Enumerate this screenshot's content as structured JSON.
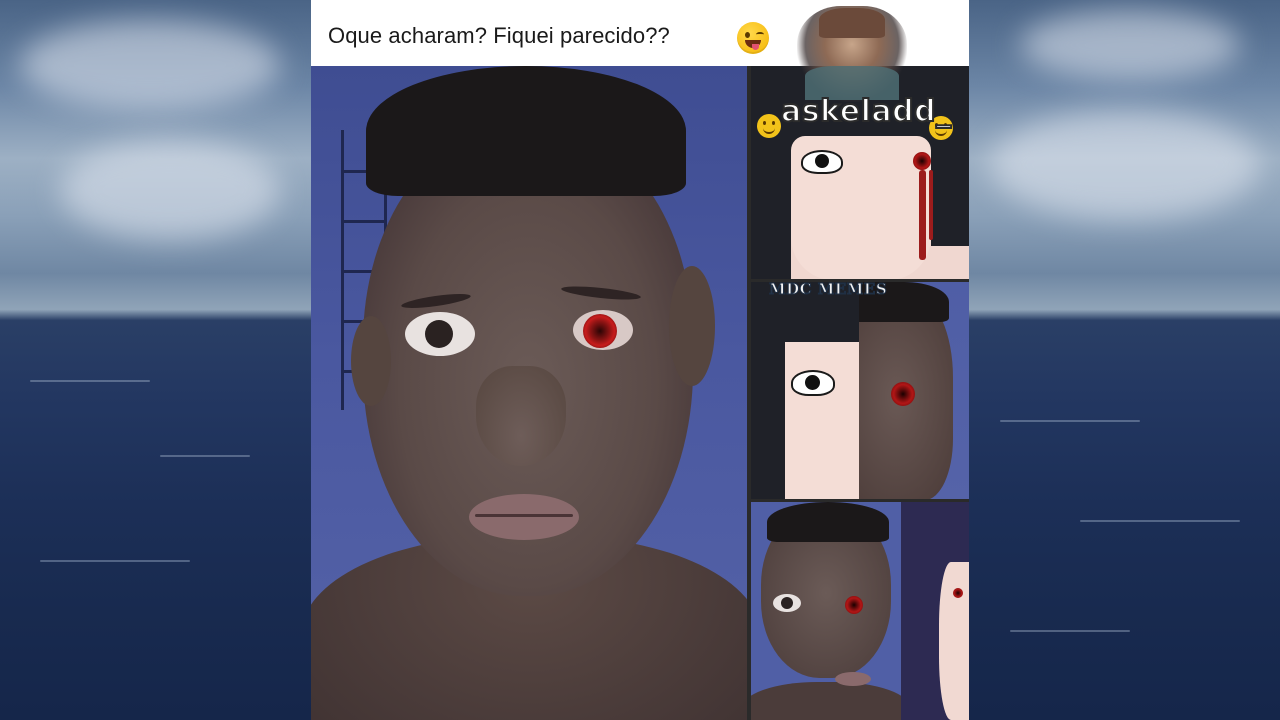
{
  "post": {
    "caption": "Oque acharam? Fiquei parecido??",
    "caption_emoji": "winking-face-with-tongue-emoji"
  },
  "overlays": {
    "watermark_top": "askeladd_",
    "watermark_mid": "MDC MEMES"
  },
  "colors": {
    "ocean": "#1c2f57",
    "sky": "#8aa0b8",
    "photo_background": "#4a58a0",
    "sharingan_red": "#b21616"
  }
}
